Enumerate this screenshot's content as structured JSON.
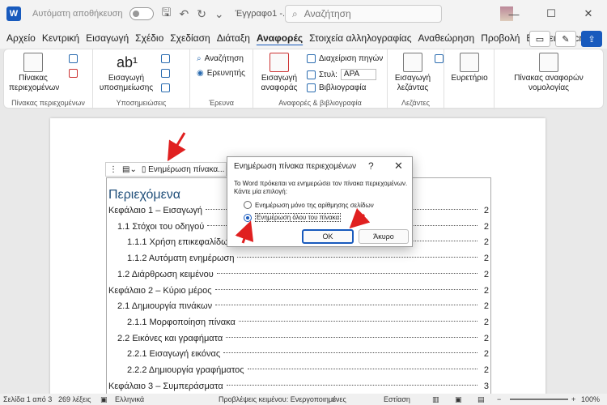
{
  "titlebar": {
    "autosave_label": "Αυτόματη αποθήκευση",
    "document_title": "Έγγραφο1 -...",
    "search_placeholder": "Αναζήτηση",
    "minimize": "—",
    "maximize": "☐",
    "close": "✕"
  },
  "menu": {
    "tabs": [
      "Αρχείο",
      "Κεντρική",
      "Εισαγωγή",
      "Σχέδιο",
      "Σχεδίαση",
      "Διάταξη",
      "Αναφορές",
      "Στοιχεία αλληλογραφίας",
      "Αναθεώρηση",
      "Προβολή",
      "Βοήθεια",
      "Acrobat"
    ],
    "active_tab": "Αναφορές"
  },
  "ribbon": {
    "toc_button": "Πίνακας περιεχομένων",
    "toc_group": "Πίνακας περιεχομένων",
    "footnote_button": "Εισαγωγή υποσημείωσης",
    "footnote_group": "Υποσημειώσεις",
    "search_button": "Αναζήτηση",
    "researcher_button": "Ερευνητής",
    "research_group": "Έρευνα",
    "citation_button": "Εισαγωγή αναφοράς",
    "manage_sources": "Διαχείριση πηγών",
    "style_label": "Στυλ:",
    "style_value": "APA",
    "bibliography": "Βιβλιογραφία",
    "citations_group": "Αναφορές & βιβλιογραφία",
    "caption_button": "Εισαγωγή λεζάντας",
    "captions_group": "Λεζάντες",
    "index_button": "Ευρετήριο",
    "authorities_button": "Πίνακας αναφορών νομολογίας"
  },
  "toc_toolbar": {
    "update_label": "Ενημέρωση πίνακα..."
  },
  "document": {
    "toc_title": "Περιεχόμενα",
    "entries": [
      {
        "text": "Κεφάλαιο 1 – Εισαγωγή",
        "page": "2",
        "level": 1
      },
      {
        "text": "1.1 Στόχοι του οδηγού",
        "page": "2",
        "level": 2
      },
      {
        "text": "1.1.1 Χρήση επικεφαλίδων",
        "page": "2",
        "level": 3
      },
      {
        "text": "1.1.2 Αυτόματη ενημέρωση",
        "page": "2",
        "level": 3
      },
      {
        "text": "1.2 Διάρθρωση κειμένου",
        "page": "2",
        "level": 2
      },
      {
        "text": "Κεφάλαιο 2 – Κύριο μέρος",
        "page": "2",
        "level": 1
      },
      {
        "text": "2.1 Δημιουργία πινάκων",
        "page": "2",
        "level": 2
      },
      {
        "text": "2.1.1 Μορφοποίηση πίνακα",
        "page": "2",
        "level": 3
      },
      {
        "text": "2.2 Εικόνες και γραφήματα",
        "page": "2",
        "level": 2
      },
      {
        "text": "2.2.1 Εισαγωγή εικόνας",
        "page": "2",
        "level": 3
      },
      {
        "text": "2.2.2 Δημιουργία γραφήματος",
        "page": "2",
        "level": 3
      },
      {
        "text": "Κεφάλαιο 3 – Συμπεράσματα",
        "page": "3",
        "level": 1
      }
    ]
  },
  "dialog": {
    "title": "Ενημέρωση πίνακα περιεχομένων",
    "help": "?",
    "close": "✕",
    "message": "Το Word πρόκειται να ενημερώσει τον πίνακα περιεχομένων. Κάντε μία επιλογή:",
    "option_pages": "Ενημέρωση μόνο της αρίθμησης σελίδων",
    "option_entire": "Ενημέρωση όλου του πίνακα",
    "ok": "OK",
    "cancel": "Άκυρο"
  },
  "statusbar": {
    "page": "Σελίδα 1 από 3",
    "words": "269 λέξεις",
    "language": "Ελληνικά",
    "predictions": "Προβλέψεις κειμένου: Ενεργοποιημένες",
    "focus": "Εστίαση",
    "zoom": "100%"
  },
  "colors": {
    "accent": "#185abd",
    "arrow": "#e02020",
    "heading": "#1f4e79"
  }
}
